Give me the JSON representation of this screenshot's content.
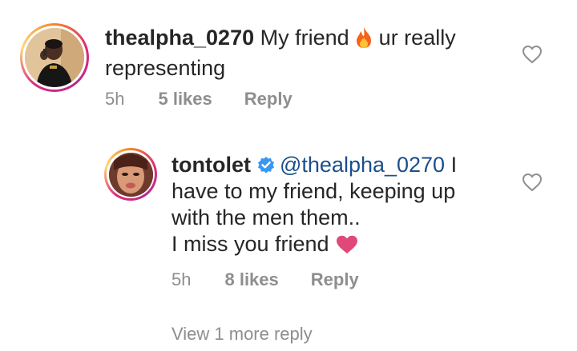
{
  "comments": [
    {
      "username": "thealpha_0270",
      "text_before_emoji": "My friend ",
      "text_after_emoji": " ur really representing",
      "emoji": "fire-emoji",
      "time": "5h",
      "likes": "5 likes",
      "reply_label": "Reply",
      "like_icon": "heart-outline-icon"
    },
    {
      "username": "tontolet",
      "verified": true,
      "mention": "@thealpha_0270",
      "text_line1": " I have to my friend, keeping up with the men them..",
      "text_line2": "I miss you friend ",
      "emoji": "pink-heart-emoji",
      "time": "5h",
      "likes": "8 likes",
      "reply_label": "Reply",
      "like_icon": "heart-outline-icon"
    }
  ],
  "view_more_replies": "View 1 more reply",
  "colors": {
    "text": "#262626",
    "muted": "#8e8e8e",
    "mention": "#1a4f8a",
    "verified_badge": "#3897f0",
    "pink_heart": "#e0487a",
    "fire": "#f5621b"
  }
}
